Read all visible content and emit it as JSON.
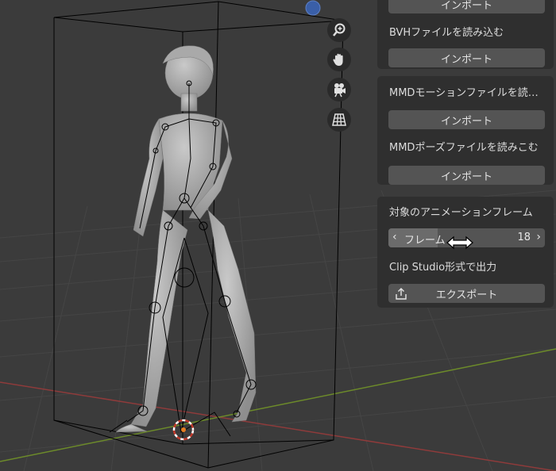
{
  "panel": {
    "top_button_label": "インポート",
    "bvh_label": "BVHファイルを読み込む",
    "bvh_button": "インポート",
    "mmd_motion_label": "MMDモーションファイルを読…",
    "mmd_motion_button": "インポート",
    "mmd_pose_label": "MMDポーズファイルを読みこむ",
    "mmd_pose_button": "インポート",
    "target_frame_label": "対象のアニメーションフレーム",
    "frame_field": {
      "name": "フレーム",
      "value": "18"
    },
    "clip_label": "Clip Studio形式で出力",
    "export_button": "エクスポート"
  },
  "icons": [
    "zoom-icon",
    "hand-icon",
    "camera-icon",
    "grid-icon",
    "resize-cursor-icon",
    "export-icon"
  ],
  "colors": {
    "background": "#3a3a3a",
    "panel": "#2f2f2f",
    "button": "#545454",
    "x_axis": "#8e3b3b",
    "y_axis": "#6c8a2a"
  }
}
